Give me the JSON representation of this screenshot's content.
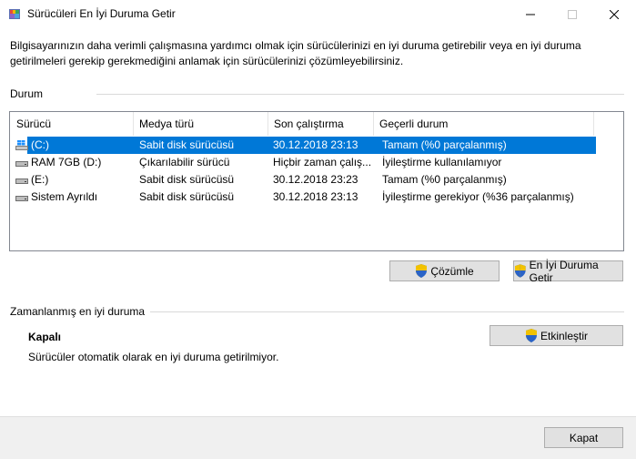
{
  "window": {
    "title": "Sürücüleri En İyi Duruma Getir"
  },
  "intro_text": "Bilgisayarınızın daha verimli çalışmasına yardımcı olmak için sürücülerinizi en iyi duruma getirebilir veya en iyi duruma getirilmeleri gerekip gerekmediğini anlamak için sürücülerinizi çözümleyebilirsiniz.",
  "status_section": {
    "label": "Durum",
    "columns": [
      "Sürücü",
      "Medya türü",
      "Son çalıştırma",
      "Geçerli durum"
    ],
    "rows": [
      {
        "drive": "(C:)",
        "media": "Sabit disk sürücüsü",
        "last_run": "30.12.2018 23:13",
        "status": "Tamam (%0 parçalanmış)",
        "icon": "windows-drive-icon",
        "selected": true
      },
      {
        "drive": "RAM 7GB (D:)",
        "media": "Çıkarılabilir sürücü",
        "last_run": "Hiçbir zaman çalış...",
        "status": "İyileştirme kullanılamıyor",
        "icon": "drive-icon",
        "selected": false
      },
      {
        "drive": "(E:)",
        "media": "Sabit disk sürücüsü",
        "last_run": "30.12.2018 23:23",
        "status": "Tamam (%0 parçalanmış)",
        "icon": "drive-icon",
        "selected": false
      },
      {
        "drive": "Sistem Ayrıldı",
        "media": "Sabit disk sürücüsü",
        "last_run": "30.12.2018 23:13",
        "status": "İyileştirme gerekiyor (%36 parçalanmış)",
        "icon": "drive-icon",
        "selected": false
      }
    ],
    "analyze_button": "Çözümle",
    "optimize_button": "En İyi Duruma Getir"
  },
  "schedule_section": {
    "label": "Zamanlanmış en iyi duruma",
    "state": "Kapalı",
    "description": "Sürücüler otomatik olarak en iyi duruma getirilmiyor.",
    "enable_button": "Etkinleştir"
  },
  "footer": {
    "close_button": "Kapat"
  },
  "colors": {
    "selection": "#0078d7",
    "button_bg": "#e1e1e1",
    "footer_bg": "#f0f0f0"
  }
}
